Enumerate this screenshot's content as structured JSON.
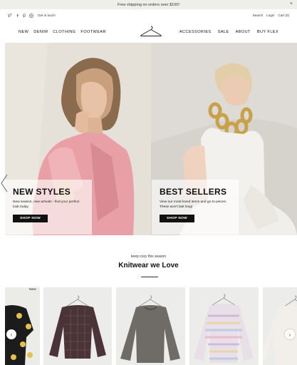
{
  "announcement": {
    "text": "Free shipping on orders over $100!",
    "close_icon": "close-icon"
  },
  "utility": {
    "social_icons": [
      "twitter-icon",
      "facebook-icon",
      "pinterest-icon",
      "instagram-icon"
    ],
    "get_in_touch": "Get in touch",
    "search": "Search",
    "login": "Login",
    "cart": "Cart (0)"
  },
  "nav": {
    "left": [
      "NEW",
      "DENIM",
      "CLOTHING",
      "FOOTWEAR"
    ],
    "right": [
      "ACCESSORIES",
      "SALE",
      "ABOUT",
      "BUY FLEX"
    ],
    "logo_icon": "hanger-logo-icon"
  },
  "hero": {
    "left": {
      "title": "NEW STYLES",
      "text": "New season, new arrivals - find your perfect look today",
      "button": "SHOP NOW"
    },
    "right": {
      "title": "BEST SELLERS",
      "text": "View our most-loved items and go-to pieces. These won't last long!",
      "button": "SHOP NOW"
    }
  },
  "section": {
    "kicker": "keep cozy this season",
    "title": "Knitwear we Love"
  },
  "products": {
    "badge": "New",
    "prev_icon": "chevron-left-icon",
    "next_icon": "chevron-right-icon"
  },
  "colors": {
    "accent": "#111111",
    "announcement_bg": "#efefea",
    "card_bg": "#ececea"
  }
}
